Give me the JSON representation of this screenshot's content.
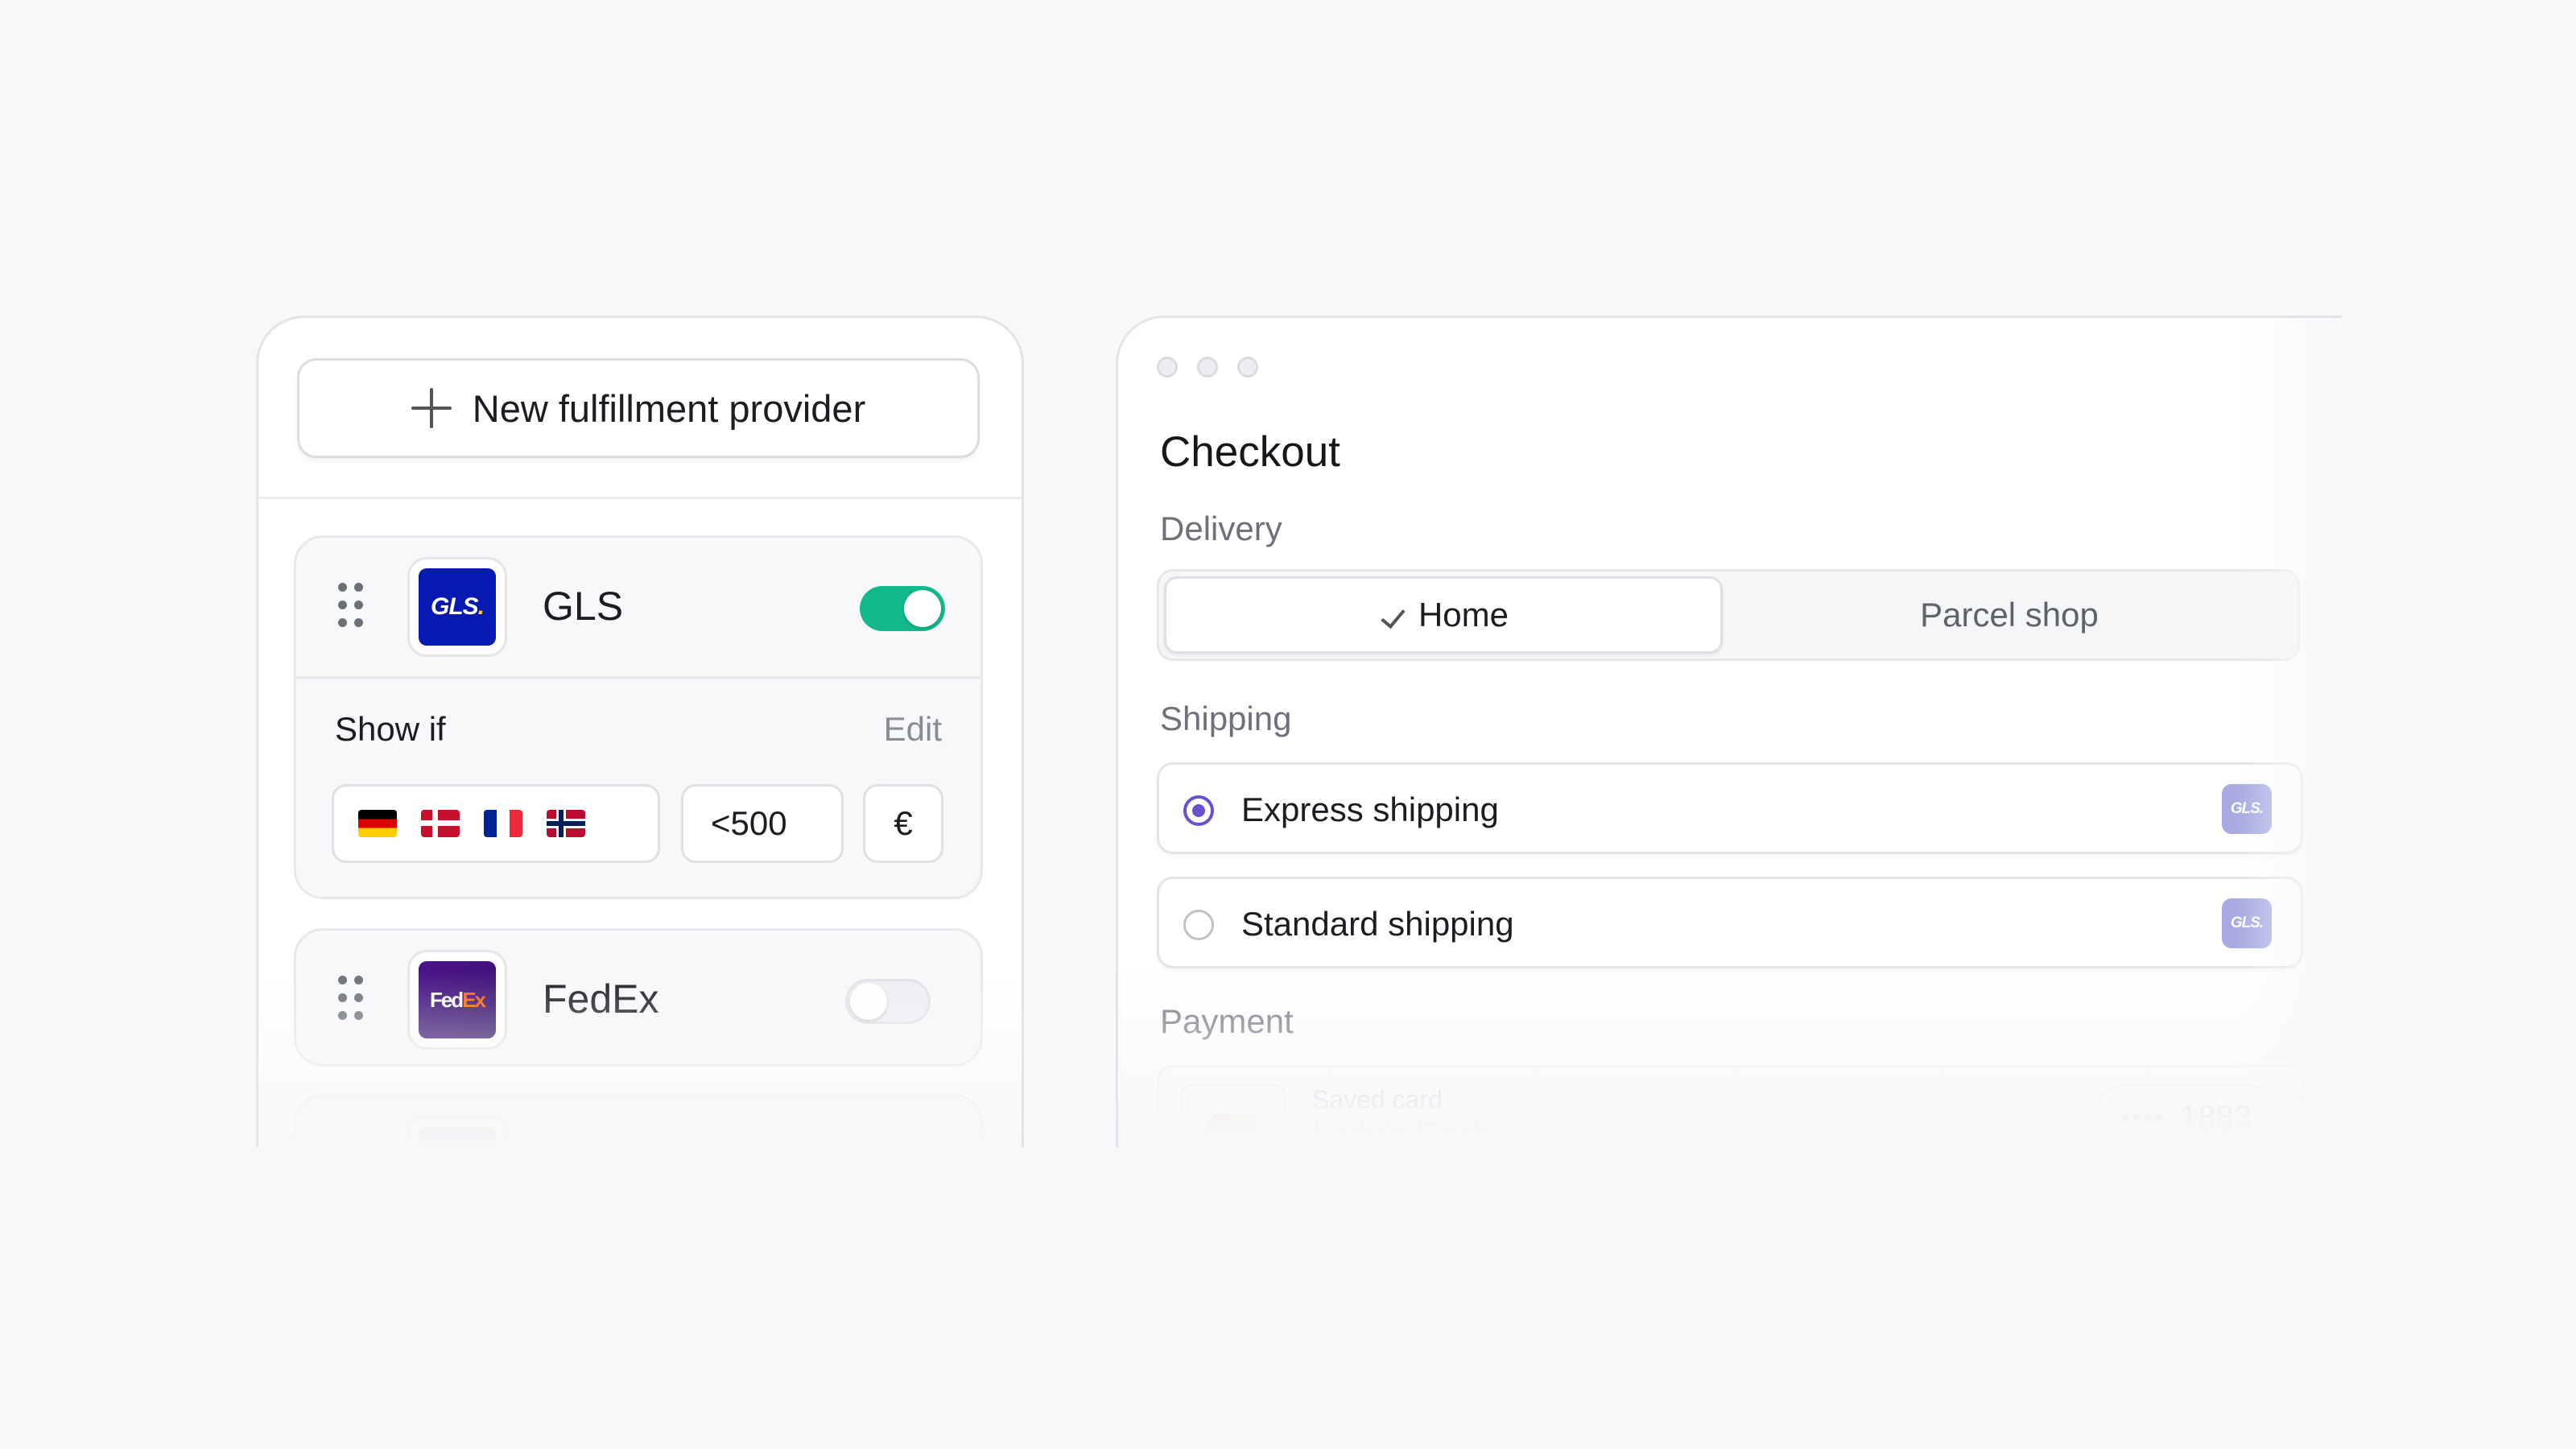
{
  "providers_panel": {
    "new_provider_label": "New fulfillment provider",
    "providers": [
      {
        "name": "GLS",
        "logo_text": "GLS",
        "enabled": true
      },
      {
        "name": "FedEx",
        "logo_text_a": "Fed",
        "logo_text_b": "Ex",
        "enabled": false
      }
    ],
    "conditions": {
      "show_if_label": "Show if",
      "edit_label": "Edit",
      "countries": [
        "Germany",
        "Denmark",
        "France",
        "Norway"
      ],
      "amount": "<500",
      "currency": "€"
    }
  },
  "checkout": {
    "title": "Checkout",
    "delivery_label": "Delivery",
    "delivery_options": [
      "Home",
      "Parcel shop"
    ],
    "delivery_selected": "Home",
    "shipping_label": "Shipping",
    "shipping_options": [
      {
        "label": "Express shipping",
        "selected": true,
        "carrier": "GLS."
      },
      {
        "label": "Standard shipping",
        "selected": false,
        "carrier": "GLS."
      }
    ],
    "payment_label": "Payment",
    "payment": {
      "saved_card_label": "Saved card",
      "card_holder": "Ludvig Rask",
      "masked_dots": "••••",
      "last_four": "1883"
    }
  },
  "colors": {
    "toggle_on": "#13b98a",
    "radio_accent": "#6a4fd1",
    "gls_blue": "#061ab1",
    "gls_yellow": "#ffd100",
    "fedex_purple": "#4d148c",
    "fedex_orange": "#ff6200"
  }
}
